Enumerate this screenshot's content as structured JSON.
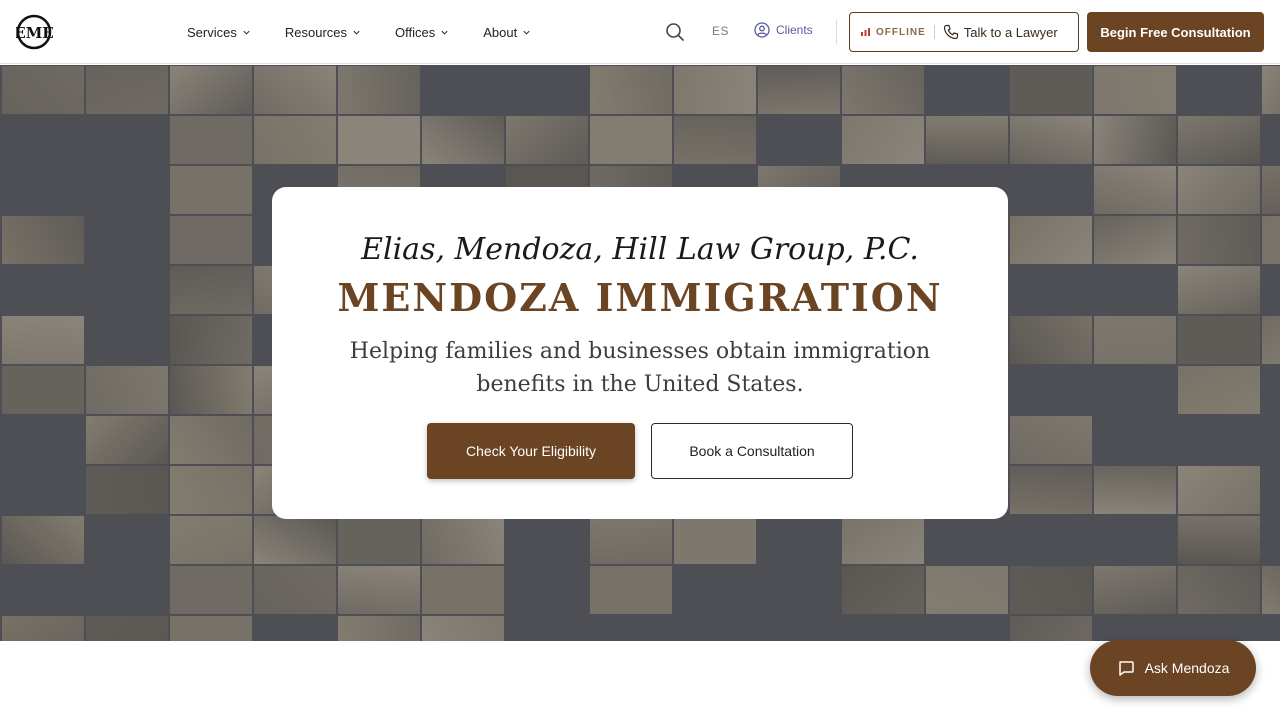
{
  "header": {
    "logo_letters": "EME",
    "nav": [
      {
        "label": "Services"
      },
      {
        "label": "Resources"
      },
      {
        "label": "Offices"
      },
      {
        "label": "About"
      }
    ],
    "language_label": "ES",
    "clients_label": "Clients",
    "status_label": "OFFLINE",
    "talk_label": "Talk to a Lawyer",
    "consult_label": "Begin Free Consultation"
  },
  "hero": {
    "signature_text": "Elias, Mendoza, Hill Law Group, P.C.",
    "brand": "MENDOZA IMMIGRATION",
    "tagline": "Helping families and businesses obtain immigration benefits in the United States.",
    "primary_cta": "Check Your Eligibility",
    "secondary_cta": "Book a Consultation"
  },
  "chat": {
    "label": "Ask Mendoza"
  },
  "colors": {
    "brand_brown": "#6b4423",
    "hero_bg": "#4e4f55",
    "clients_link": "#5a5aa0",
    "status_bars": "#c0392b"
  }
}
